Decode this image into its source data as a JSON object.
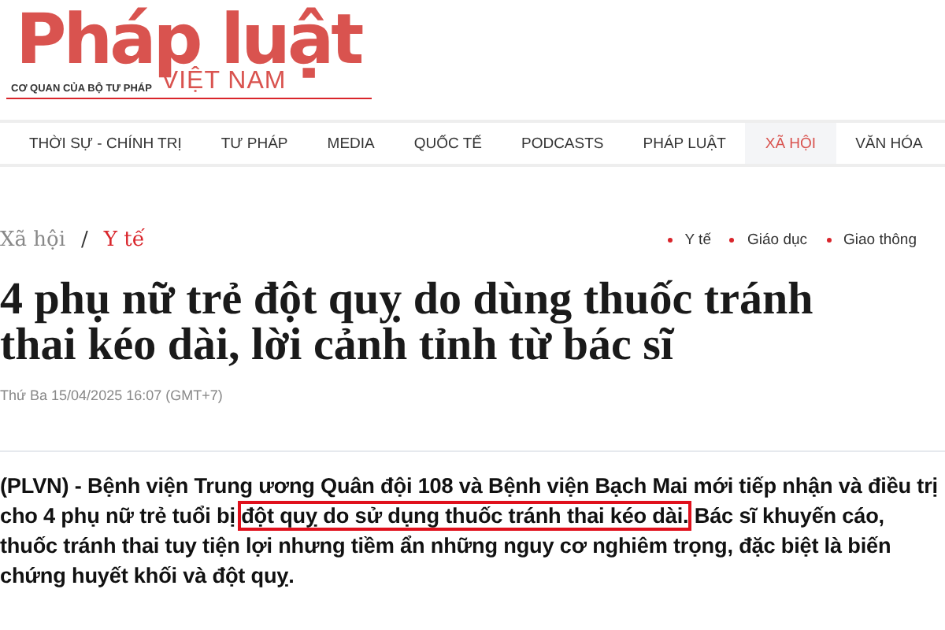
{
  "logo": {
    "title": "Pháp luật",
    "tagline": "CƠ QUAN CỦA BỘ TƯ PHÁP",
    "subtitle": "VIỆT NAM"
  },
  "nav": [
    {
      "label": "THỜI SỰ - CHÍNH TRỊ",
      "selected": false
    },
    {
      "label": "TƯ PHÁP",
      "selected": false
    },
    {
      "label": "MEDIA",
      "selected": false
    },
    {
      "label": "QUỐC TẾ",
      "selected": false
    },
    {
      "label": "PODCASTS",
      "selected": false
    },
    {
      "label": "PHÁP LUẬT",
      "selected": false
    },
    {
      "label": "XÃ HỘI",
      "selected": true
    },
    {
      "label": "VĂN HÓA",
      "selected": false
    }
  ],
  "breadcrumb": {
    "section": "Xã hội",
    "separator": "/",
    "current": "Y tế"
  },
  "related_tags": [
    "Y tế",
    "Giáo dục",
    "Giao thông"
  ],
  "article": {
    "title": "4 phụ nữ trẻ đột quỵ do dùng thuốc tránh thai kéo dài, lời cảnh tỉnh từ bác sĩ",
    "date": "Thứ Ba 15/04/2025 16:07 (GMT+7)",
    "lead_before": "(PLVN) - Bệnh viện Trung ương Quân đội 108 và Bệnh viện Bạch Mai mới tiếp nhận và điều trị cho 4 phụ nữ trẻ tuổi bị ",
    "lead_highlight": "đột quỵ do sử dụng thuốc tránh thai kéo dài.",
    "lead_after": " Bác sĩ khuyến cáo, thuốc tránh thai tuy tiện lợi nhưng tiềm ẩn những nguy cơ nghiêm trọng, đặc biệt là biến chứng huyết khối và đột quỵ."
  }
}
